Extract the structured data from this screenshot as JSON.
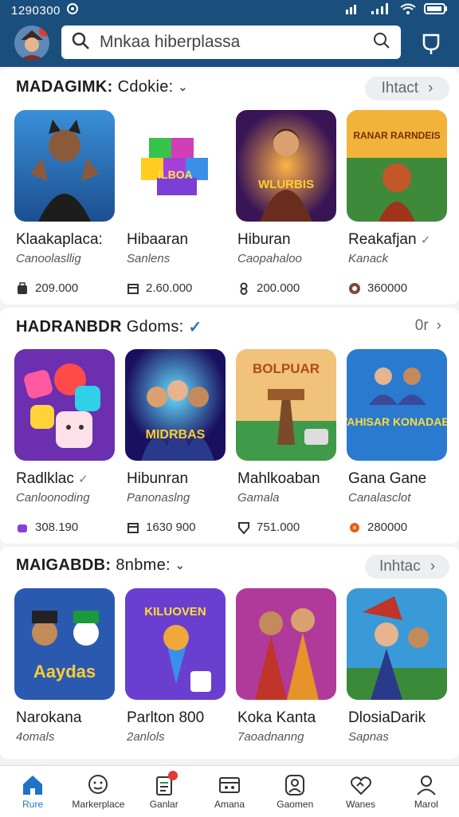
{
  "status": {
    "time": "1290300"
  },
  "search": {
    "value": "Mnkaa hiberplassa"
  },
  "sections": [
    {
      "title": "MADAGIMK:",
      "subtitle": "Cdokie:",
      "action": "Ihtact",
      "items": [
        {
          "name": "Klaakaplaca:",
          "sub": "Canoolasllig",
          "stat": "209.000",
          "art_text": ""
        },
        {
          "name": "Hibaaran",
          "sub": "Sanlens",
          "stat": "2.60.000",
          "art_text": "ILBOA"
        },
        {
          "name": "Hiburan",
          "sub": "Caopahaloo",
          "stat": "200.000",
          "art_text": "WLURBIS"
        },
        {
          "name": "Reakafjan",
          "sub": "Kanack",
          "stat": "360000",
          "art_text": "RANAR RARNDEIS"
        }
      ]
    },
    {
      "title": "HADRANBDR",
      "subtitle": "Gdoms:",
      "action": "0r",
      "items": [
        {
          "name": "Radlklac",
          "sub": "Canloonoding",
          "stat": "308.190",
          "art_text": ""
        },
        {
          "name": "Hibunran",
          "sub": "Panonaslng",
          "stat": "1630 900",
          "art_text": "MIDRBAS"
        },
        {
          "name": "Mahlkoaban",
          "sub": "Gamala",
          "stat": "751.000",
          "art_text": "BOLPUAR"
        },
        {
          "name": "Gana Gane",
          "sub": "Canalasclot",
          "stat": "280000",
          "art_text": "WAHISAR KONADAES"
        }
      ]
    },
    {
      "title": "MAIGABDB:",
      "subtitle": "8nbme:",
      "action": "Inhtac",
      "items": [
        {
          "name": "Narokana",
          "sub": "4omals",
          "art_text": "Aaydas"
        },
        {
          "name": "Parlton 800",
          "sub": "2anlols",
          "art_text": "KILUOVEN"
        },
        {
          "name": "Koka Kanta",
          "sub": "7aoadnanng",
          "art_text": ""
        },
        {
          "name": "DlosiaDarik",
          "sub": "Sapnas",
          "art_text": ""
        }
      ]
    }
  ],
  "nav": [
    {
      "label": "Rure",
      "icon": "home-icon",
      "active": true
    },
    {
      "label": "Markerplace",
      "icon": "chat-face-icon"
    },
    {
      "label": "Ganlar",
      "icon": "clipboard-icon"
    },
    {
      "label": "Amana",
      "icon": "card-icon"
    },
    {
      "label": "Gaomen",
      "icon": "person-frame-icon"
    },
    {
      "label": "Wanes",
      "icon": "heart-handshake-icon"
    },
    {
      "label": "Marol",
      "icon": "user-icon"
    }
  ],
  "colors": {
    "brand": "#1a4f7d",
    "accent": "#1e73c8",
    "badge": "#e53935"
  }
}
